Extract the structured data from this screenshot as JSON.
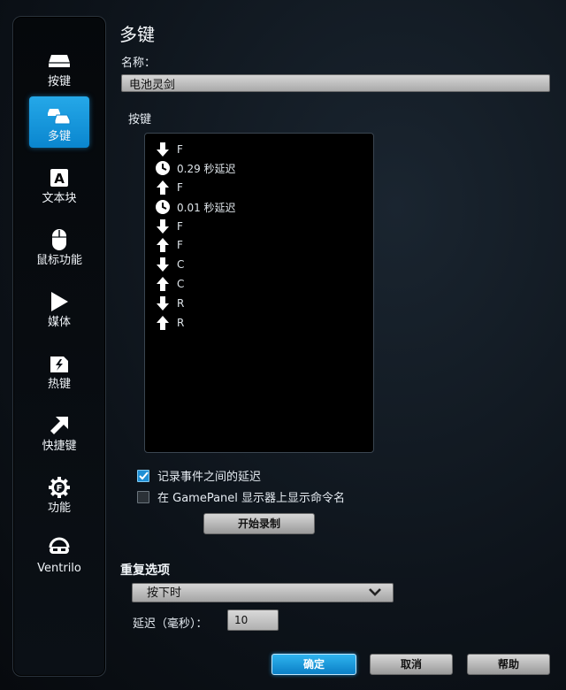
{
  "title": "多键",
  "name_label": "名称：",
  "name_value": "电池灵剑",
  "keys_label": "按键",
  "sidebar": {
    "items": [
      {
        "label": "按键",
        "icon": "key-icon",
        "active": false
      },
      {
        "label": "多键",
        "icon": "multikey-icon",
        "active": true
      },
      {
        "label": "文本块",
        "icon": "text-block-icon",
        "active": false
      },
      {
        "label": "鼠标功能",
        "icon": "mouse-icon",
        "active": false
      },
      {
        "label": "媒体",
        "icon": "play-icon",
        "active": false
      },
      {
        "label": "热键",
        "icon": "hotkey-icon",
        "active": false
      },
      {
        "label": "快捷键",
        "icon": "shortcut-arrow-icon",
        "active": false
      },
      {
        "label": "功能",
        "icon": "gear-f-icon",
        "active": false
      },
      {
        "label": "Ventrilo",
        "icon": "headset-icon",
        "active": false
      }
    ]
  },
  "events": [
    {
      "icon": "arrow-down-icon",
      "text": "F"
    },
    {
      "icon": "clock-icon",
      "text": "0.29 秒延迟"
    },
    {
      "icon": "arrow-up-icon",
      "text": "F"
    },
    {
      "icon": "clock-icon",
      "text": "0.01 秒延迟"
    },
    {
      "icon": "arrow-down-icon",
      "text": "F"
    },
    {
      "icon": "arrow-up-icon",
      "text": "F"
    },
    {
      "icon": "arrow-down-icon",
      "text": "C"
    },
    {
      "icon": "arrow-up-icon",
      "text": "C"
    },
    {
      "icon": "arrow-down-icon",
      "text": "R"
    },
    {
      "icon": "arrow-up-icon",
      "text": "R"
    }
  ],
  "options": {
    "record_delays": {
      "label": "记录事件之间的延迟",
      "checked": true
    },
    "show_on_gamepanel": {
      "label": "在 GamePanel 显示器上显示命令名",
      "checked": false
    }
  },
  "start_record_label": "开始录制",
  "repeat_label": "重复选项",
  "repeat_selected": "按下时",
  "delay_label": "延迟（毫秒）：",
  "delay_value": "10",
  "ok_label": "确定",
  "cancel_label": "取消",
  "help_label": "帮助",
  "accent_color": "#1a9be0"
}
